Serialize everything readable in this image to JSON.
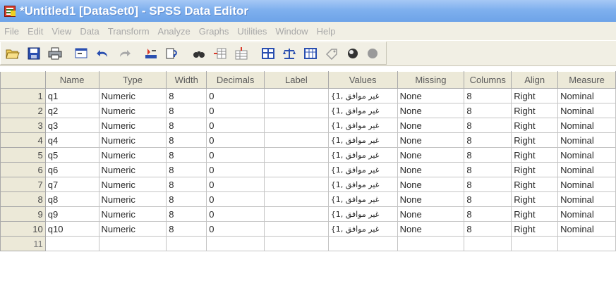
{
  "window": {
    "title": "*Untitled1 [DataSet0] - SPSS Data Editor"
  },
  "menu": [
    "File",
    "Edit",
    "View",
    "Data",
    "Transform",
    "Analyze",
    "Graphs",
    "Utilities",
    "Window",
    "Help"
  ],
  "toolbar": {
    "icons": [
      "open-icon",
      "save-icon",
      "print-icon",
      "dialog-recall-icon",
      "undo-icon",
      "redo-icon",
      "goto-case-icon",
      "variables-icon",
      "find-icon",
      "insert-cases-icon",
      "insert-variable-icon",
      "split-file-icon",
      "weight-cases-icon",
      "select-cases-icon",
      "value-labels-icon",
      "use-sets-icon",
      "show-all-icon"
    ]
  },
  "grid": {
    "columns": [
      "Name",
      "Type",
      "Width",
      "Decimals",
      "Label",
      "Values",
      "Missing",
      "Columns",
      "Align",
      "Measure"
    ],
    "rows": [
      {
        "num": "1",
        "name": "q1",
        "type": "Numeric",
        "width": "8",
        "decimals": "0",
        "label": "",
        "values": "{1, غير موافق",
        "missing": "None",
        "columns": "8",
        "align": "Right",
        "measure": "Nominal"
      },
      {
        "num": "2",
        "name": "q2",
        "type": "Numeric",
        "width": "8",
        "decimals": "0",
        "label": "",
        "values": "{1, غير موافق",
        "missing": "None",
        "columns": "8",
        "align": "Right",
        "measure": "Nominal"
      },
      {
        "num": "3",
        "name": "q3",
        "type": "Numeric",
        "width": "8",
        "decimals": "0",
        "label": "",
        "values": "{1, غير موافق",
        "missing": "None",
        "columns": "8",
        "align": "Right",
        "measure": "Nominal"
      },
      {
        "num": "4",
        "name": "q4",
        "type": "Numeric",
        "width": "8",
        "decimals": "0",
        "label": "",
        "values": "{1, غير موافق",
        "missing": "None",
        "columns": "8",
        "align": "Right",
        "measure": "Nominal"
      },
      {
        "num": "5",
        "name": "q5",
        "type": "Numeric",
        "width": "8",
        "decimals": "0",
        "label": "",
        "values": "{1, غير موافق",
        "missing": "None",
        "columns": "8",
        "align": "Right",
        "measure": "Nominal"
      },
      {
        "num": "6",
        "name": "q6",
        "type": "Numeric",
        "width": "8",
        "decimals": "0",
        "label": "",
        "values": "{1, غير موافق",
        "missing": "None",
        "columns": "8",
        "align": "Right",
        "measure": "Nominal"
      },
      {
        "num": "7",
        "name": "q7",
        "type": "Numeric",
        "width": "8",
        "decimals": "0",
        "label": "",
        "values": "{1, غير موافق",
        "missing": "None",
        "columns": "8",
        "align": "Right",
        "measure": "Nominal"
      },
      {
        "num": "8",
        "name": "q8",
        "type": "Numeric",
        "width": "8",
        "decimals": "0",
        "label": "",
        "values": "{1, غير موافق",
        "missing": "None",
        "columns": "8",
        "align": "Right",
        "measure": "Nominal"
      },
      {
        "num": "9",
        "name": "q9",
        "type": "Numeric",
        "width": "8",
        "decimals": "0",
        "label": "",
        "values": "{1, غير موافق",
        "missing": "None",
        "columns": "8",
        "align": "Right",
        "measure": "Nominal"
      },
      {
        "num": "10",
        "name": "q10",
        "type": "Numeric",
        "width": "8",
        "decimals": "0",
        "label": "",
        "values": "{1, غير موافق",
        "missing": "None",
        "columns": "8",
        "align": "Right",
        "measure": "Nominal"
      },
      {
        "num": "11",
        "name": "",
        "type": "",
        "width": "",
        "decimals": "",
        "label": "",
        "values": "",
        "missing": "",
        "columns": "",
        "align": "",
        "measure": ""
      }
    ]
  }
}
